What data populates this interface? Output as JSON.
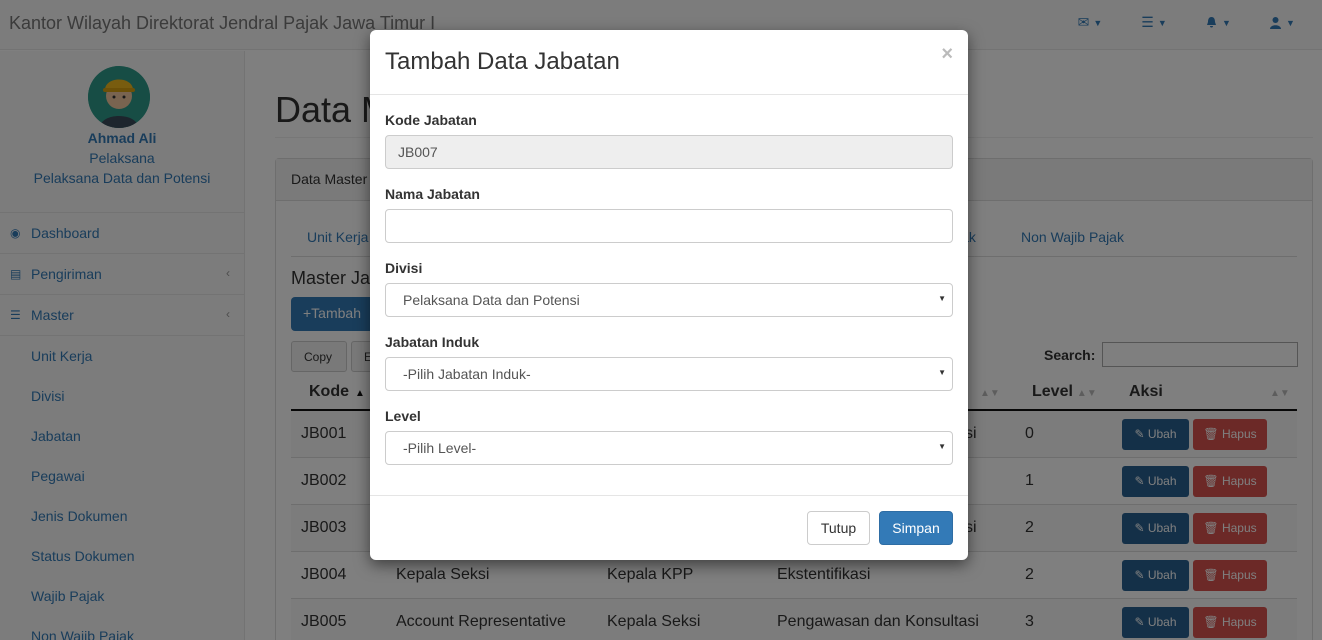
{
  "app_title": "Kantor Wilayah Direktorat Jendral Pajak Jawa Timur I",
  "topbar_icons": [
    "envelope-icon",
    "tasks-icon",
    "bell-icon",
    "user-icon"
  ],
  "user": {
    "name": "Ahmad Ali",
    "role": "Pelaksana",
    "division": "Pelaksana Data dan Potensi"
  },
  "sidebar": {
    "items": [
      {
        "label": "Dashboard",
        "icon": "dashboard-icon"
      },
      {
        "label": "Pengiriman",
        "icon": "bar-chart-icon"
      },
      {
        "label": "Master",
        "icon": "list-icon"
      }
    ],
    "sub_items": [
      "Unit Kerja",
      "Divisi",
      "Jabatan",
      "Pegawai",
      "Jenis Dokumen",
      "Status Dokumen",
      "Wajib Pajak",
      "Non Wajib Pajak"
    ]
  },
  "main": {
    "page_title": "Data M",
    "panel_heading": "Data Master",
    "tabs": {
      "first": "Unit Kerja",
      "partial": "jak",
      "last": "Non Wajib Pajak"
    },
    "section_title": "Master Ja",
    "add_button": "+Tambah",
    "copy_button": "Copy",
    "e_button": "E",
    "search_label": "Search:"
  },
  "table": {
    "headers": {
      "kode": "Kode",
      "level": "Level",
      "aksi": "Aksi"
    },
    "ubah_label": "Ubah",
    "hapus_label": "Hapus",
    "rows": [
      {
        "kode": "JB001",
        "nama": "",
        "induk": "",
        "divisi": "si",
        "level": "0"
      },
      {
        "kode": "JB002",
        "nama": "",
        "induk": "",
        "divisi": "",
        "level": "1"
      },
      {
        "kode": "JB003",
        "nama": "",
        "induk": "",
        "divisi": "si",
        "level": "2"
      },
      {
        "kode": "JB004",
        "nama": "Kepala Seksi",
        "induk": "Kepala KPP",
        "divisi": "Ekstentifikasi",
        "level": "2"
      },
      {
        "kode": "JB005",
        "nama": "Account Representative",
        "induk": "Kepala Seksi",
        "divisi": "Pengawasan dan Konsultasi",
        "level": "3"
      }
    ]
  },
  "modal": {
    "title": "Tambah Data Jabatan",
    "close": "×",
    "fields": {
      "kode_label": "Kode Jabatan",
      "kode_value": "JB007",
      "nama_label": "Nama Jabatan",
      "nama_value": "",
      "divisi_label": "Divisi",
      "divisi_value": "Pelaksana Data dan Potensi",
      "induk_label": "Jabatan Induk",
      "induk_value": "-Pilih Jabatan Induk-",
      "level_label": "Level",
      "level_value": "-Pilih Level-"
    },
    "tutup_label": "Tutup",
    "simpan_label": "Simpan"
  }
}
